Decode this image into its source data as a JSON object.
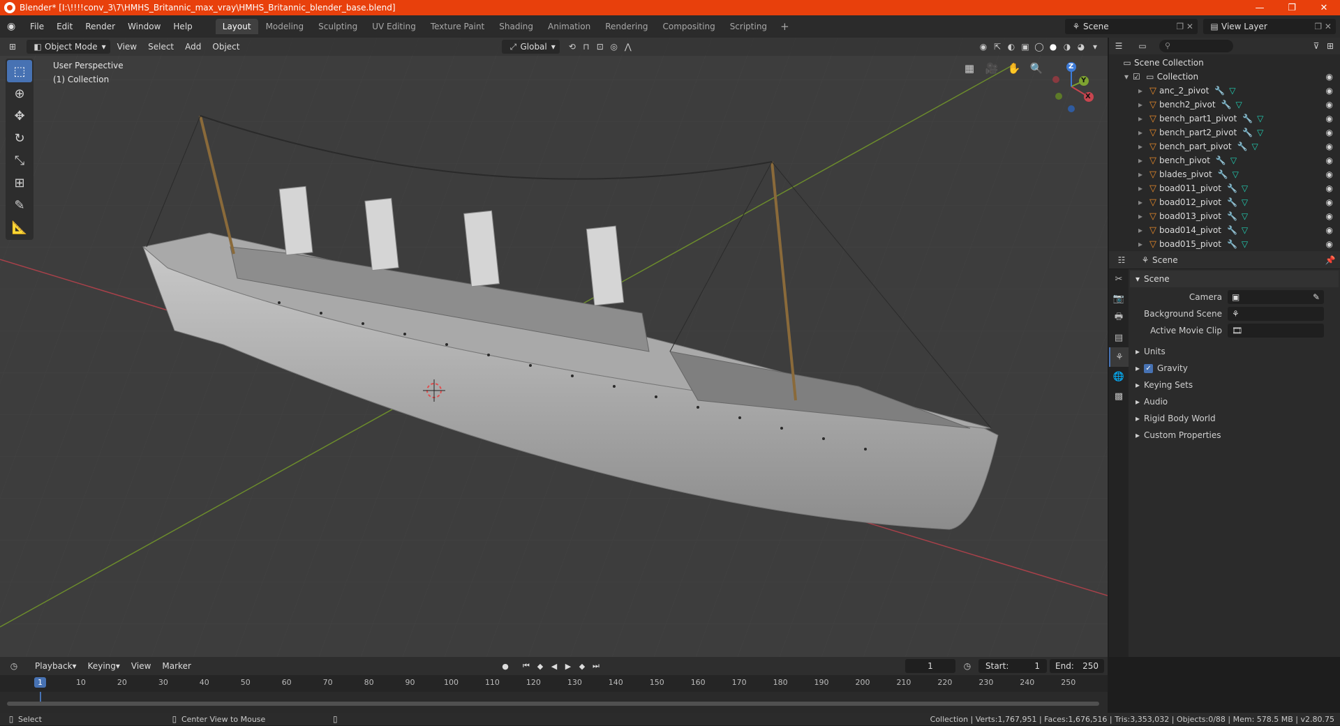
{
  "window": {
    "title": "Blender* [I:\\!!!!conv_3\\7\\HMHS_Britannic_max_vray\\HMHS_Britannic_blender_base.blend]",
    "controls": [
      "—",
      "❐",
      "✕"
    ]
  },
  "menu": {
    "items": [
      "File",
      "Edit",
      "Render",
      "Window",
      "Help"
    ]
  },
  "workspaces": {
    "tabs": [
      "Layout",
      "Modeling",
      "Sculpting",
      "UV Editing",
      "Texture Paint",
      "Shading",
      "Animation",
      "Rendering",
      "Compositing",
      "Scripting"
    ],
    "active": "Layout",
    "add": "+"
  },
  "topright": {
    "scene": "Scene",
    "view_layer": "View Layer"
  },
  "viewport": {
    "mode": "Object Mode",
    "menus": [
      "View",
      "Select",
      "Add",
      "Object"
    ],
    "orientation": "Global",
    "info_line1": "User Perspective",
    "info_line2": "(1) Collection",
    "gizmo": {
      "x": "X",
      "y": "Y",
      "z": "Z"
    },
    "colors": {
      "bg": "#3d3d3d",
      "x_axis": "#c8454f",
      "y_axis": "#7ea331",
      "z_axis": "#3d7bd8"
    }
  },
  "outliner": {
    "search_placeholder": "",
    "root": "Scene Collection",
    "collection": "Collection",
    "objects": [
      "anc_2_pivot",
      "bench2_pivot",
      "bench_part1_pivot",
      "bench_part2_pivot",
      "bench_part_pivot",
      "bench_pivot",
      "blades_pivot",
      "boad011_pivot",
      "boad012_pivot",
      "boad013_pivot",
      "boad014_pivot",
      "boad015_pivot"
    ]
  },
  "properties": {
    "context": "Scene",
    "panel": "Scene",
    "camera_label": "Camera",
    "bg_scene_label": "Background Scene",
    "movie_clip_label": "Active Movie Clip",
    "subpanels": [
      "Units",
      "Gravity",
      "Keying Sets",
      "Audio",
      "Rigid Body World",
      "Custom Properties"
    ]
  },
  "timeline": {
    "menus": [
      "Playback",
      "Keying",
      "View",
      "Marker"
    ],
    "current_frame": "1",
    "start_label": "Start:",
    "start": "1",
    "end_label": "End:",
    "end": "250",
    "ticks": [
      "10",
      "20",
      "30",
      "40",
      "50",
      "60",
      "70",
      "80",
      "90",
      "100",
      "110",
      "120",
      "130",
      "140",
      "150",
      "160",
      "170",
      "180",
      "190",
      "200",
      "210",
      "220",
      "230",
      "240",
      "250"
    ],
    "frame_indicator": "1"
  },
  "status": {
    "left1": "Select",
    "left2": "Center View to Mouse",
    "right": "Collection | Verts:1,767,951 | Faces:1,676,516 | Tris:3,353,032 | Objects:0/88 | Mem: 578.5 MB | v2.80.75"
  }
}
